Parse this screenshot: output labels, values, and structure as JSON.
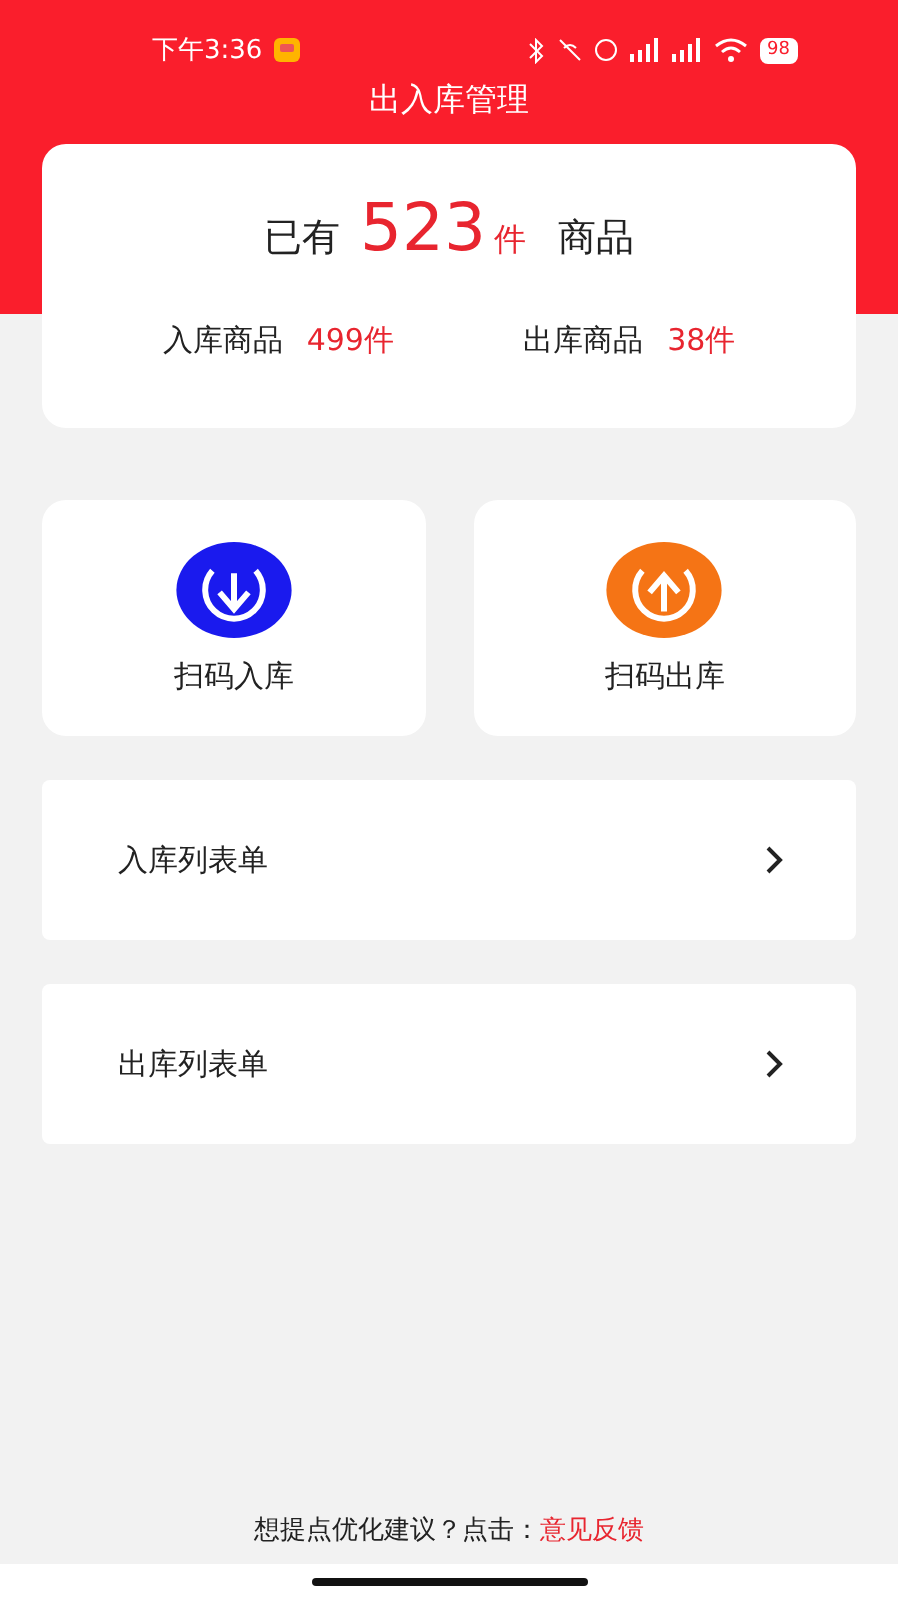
{
  "status_bar": {
    "time": "下午3:36",
    "battery": "98"
  },
  "title": "出入库管理",
  "summary": {
    "prefix": "已有",
    "total": "523",
    "unit": "件",
    "suffix": "商品",
    "stats": [
      {
        "label": "入库商品",
        "value": "499件"
      },
      {
        "label": "出库商品",
        "value": "38件"
      }
    ]
  },
  "actions": [
    {
      "label": "扫码入库",
      "kind": "in"
    },
    {
      "label": "扫码出库",
      "kind": "out"
    }
  ],
  "lists": [
    {
      "label": "入库列表单"
    },
    {
      "label": "出库列表单"
    }
  ],
  "footer": {
    "prompt": "想提点优化建议？点击：",
    "link": "意见反馈"
  }
}
